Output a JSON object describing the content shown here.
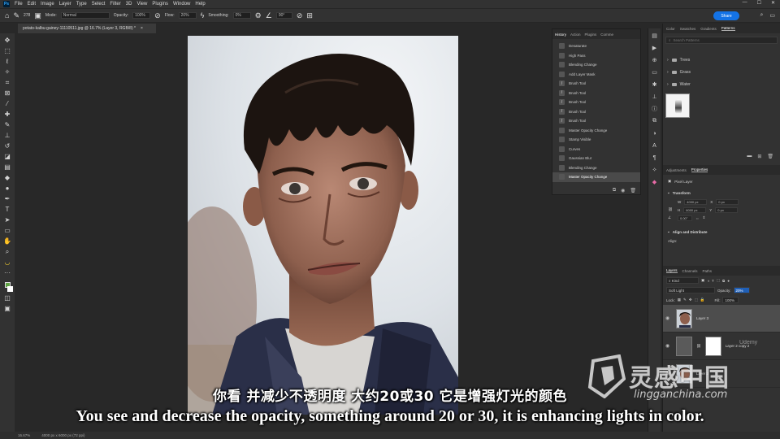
{
  "app": {
    "logo_text": "Ps",
    "menu": [
      "File",
      "Edit",
      "Image",
      "Layer",
      "Type",
      "Select",
      "Filter",
      "3D",
      "View",
      "Plugins",
      "Window",
      "Help"
    ],
    "window_controls": [
      "—",
      "☐",
      "✕"
    ]
  },
  "options_bar": {
    "mode_label": "Mode:",
    "mode_value": "Normal",
    "opacity_label": "Opacity:",
    "opacity_value": "100%",
    "flow_label": "Flow:",
    "flow_value": "20%",
    "smoothing_label": "Smoothing:",
    "smoothing_value": "0%",
    "angle_value": "90°",
    "brush_size": "278",
    "share_label": "Share"
  },
  "document": {
    "tab_title": "potato-kalbu-gainey-11110511.jpg @ 16.7% (Layer 3, RGB/8) *",
    "tab_close": "×"
  },
  "history": {
    "tabs": [
      "History",
      "Action",
      "Plugins",
      "Comme"
    ],
    "items": [
      {
        "label": "Desaturate",
        "icon": ""
      },
      {
        "label": "High Pass",
        "icon": ""
      },
      {
        "label": "Blending Change",
        "icon": ""
      },
      {
        "label": "Add Layer Mask",
        "icon": ""
      },
      {
        "label": "Brush Tool",
        "icon": "/"
      },
      {
        "label": "Brush Tool",
        "icon": "/"
      },
      {
        "label": "Brush Tool",
        "icon": "/"
      },
      {
        "label": "Brush Tool",
        "icon": "/"
      },
      {
        "label": "Brush Tool",
        "icon": "/"
      },
      {
        "label": "Master Opacity Change",
        "icon": ""
      },
      {
        "label": "Stamp Visible",
        "icon": ""
      },
      {
        "label": "Curves",
        "icon": ""
      },
      {
        "label": "Gaussian Blur",
        "icon": ""
      },
      {
        "label": "Blending Change",
        "icon": ""
      },
      {
        "label": "Master Opacity Change",
        "icon": ""
      }
    ],
    "selected_index": 14
  },
  "patterns_panel": {
    "tabs": [
      "Color",
      "Swatches",
      "Gradients",
      "Patterns"
    ],
    "search_placeholder": "Search Patterns",
    "folders": [
      "Trees",
      "Grass",
      "Water"
    ]
  },
  "properties": {
    "tabs": [
      "Adjustments",
      "Properties"
    ],
    "layer_name": "Pixel Layer",
    "transform_heading": "Transform",
    "w_label": "W",
    "w_value": "4000 px",
    "h_label": "H",
    "h_value": "6000 px",
    "x_label": "X",
    "x_value": "0 px",
    "y_label": "Y",
    "y_value": "0 px",
    "angle_value": "0.00°",
    "align_heading": "Align and Distribute",
    "align_sub": "Align:"
  },
  "layers_panel": {
    "tabs": [
      "Layers",
      "Channels",
      "Paths"
    ],
    "kind_value": "Kind",
    "blend_mode": "Soft Light",
    "opacity_label": "Opacity:",
    "opacity_value": "20%",
    "lock_label": "Lock:",
    "fill_label": "Fill:",
    "fill_value": "100%",
    "layers": [
      {
        "name": "Layer 3",
        "selected": true
      },
      {
        "name": "Layer 2 copy 2",
        "selected": false
      },
      {
        "name": "Layer 2",
        "selected": false
      }
    ]
  },
  "status_bar": {
    "zoom": "16.67%",
    "doc_size": "4000 px x 6000 px (72 ppi)"
  },
  "subtitles": {
    "chinese": "你看 并减少不透明度 大约20或30 它是增强灯光的颜色",
    "english": "You see and decrease the opacity, something around 20 or 30, it is enhancing lights in color."
  },
  "watermark": {
    "title": "灵感中国",
    "url": "lingganchina.com",
    "udemy": "Udemy"
  }
}
